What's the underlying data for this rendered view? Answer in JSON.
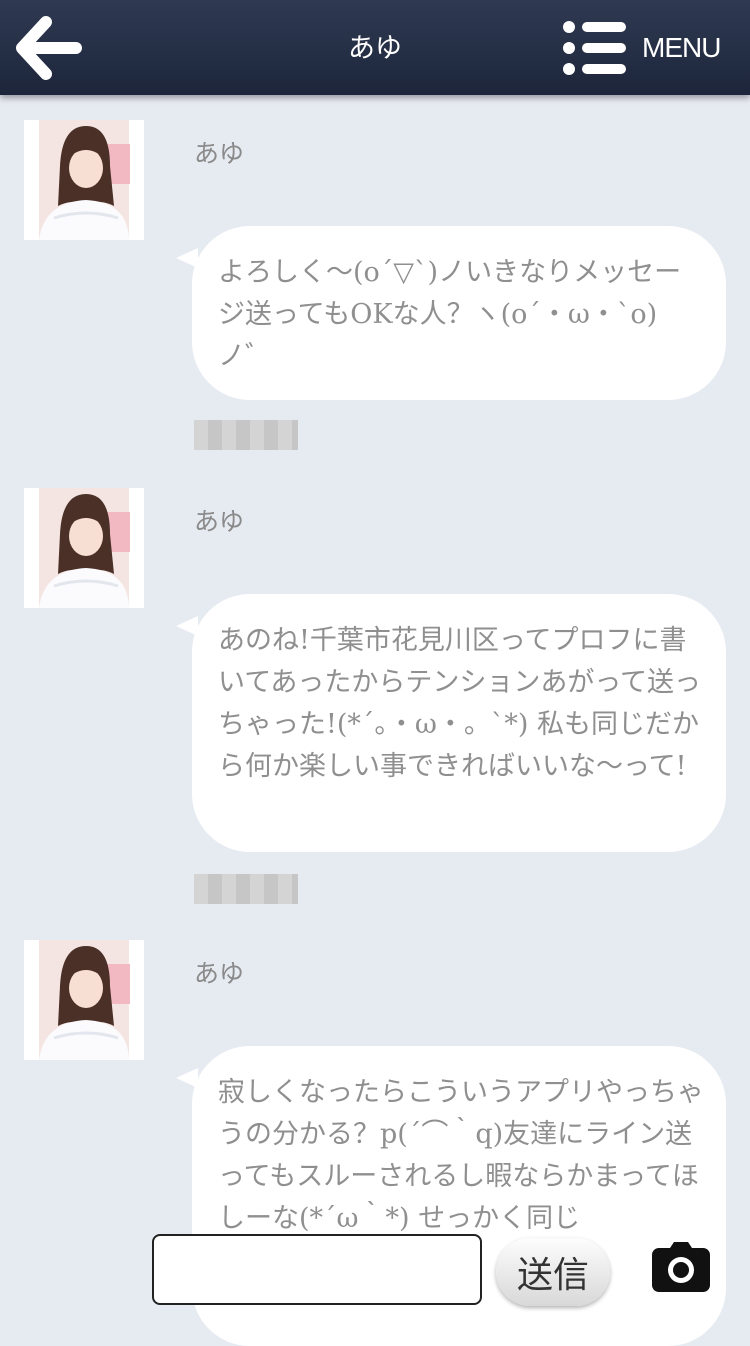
{
  "header": {
    "title": "あゆ",
    "menu_label": "MENU"
  },
  "messages": [
    {
      "sender": "あゆ",
      "text": "よろしく〜(o´▽`)ノいきなりメッセージ送ってもOKな人？ヽ(o´・ω・`o)ノ゛",
      "timestamp": ""
    },
    {
      "sender": "あゆ",
      "text": "あのね!千葉市花見川区ってプロフに書いてあったからテンションあがって送っちゃった!(*´。・ω・。`*) 私も同じだから何か楽しい事できればいいな〜って!",
      "timestamp": ""
    },
    {
      "sender": "あゆ",
      "text": "寂しくなったらこういうアプリやっちゃうの分かる？p(´⌒｀q)友達にライン送ってもスルーされるし暇ならかまってほしーな(*´ω｀*) せっかく同じ",
      "timestamp": ""
    }
  ],
  "input": {
    "value": "",
    "placeholder": "",
    "send_label": "送信"
  },
  "icons": {
    "back": "back-arrow-icon",
    "menu": "hamburger-menu-icon",
    "camera": "camera-icon"
  },
  "colors": {
    "header": "#1f283d",
    "background": "#e6ebf1",
    "bubble": "#ffffff",
    "message_text": "#8f8f8f"
  }
}
